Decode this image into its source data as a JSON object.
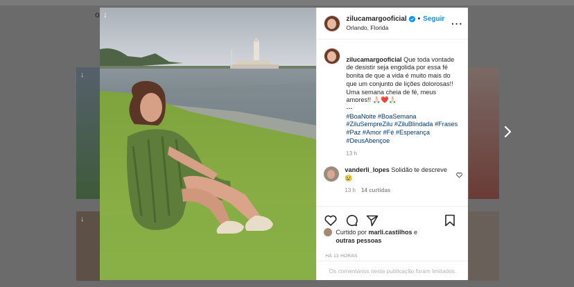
{
  "background": {
    "top_char": "o",
    "close_symbol": "↓",
    "small_icon": "↓"
  },
  "post": {
    "username": "zilucamargooficial",
    "follow_label": "Seguir",
    "location": "Orlando, Florida",
    "more_icon": "more-horizontal-icon",
    "caption": {
      "username": "zilucamargooficial",
      "text": " Que toda vontade de desistir seja engolida por essa fé bonita de que a vida é muito mais do que um conjunto de lições dolorosas!!\nUma semana cheia de fé, meus amores!! 🙏🏻❤️🙏🏻\n---\n",
      "hashtags": "#BoaNoite #BoaSemana #ZiluSempreZilu #ZiluBlindada #Frases #Paz #Amor #Fé #Esperança #DeusAbençoe",
      "time": "13 h"
    },
    "comment": {
      "username": "vanderli_lopes",
      "text": " Solidão te descreve😢",
      "time": "13 h",
      "likes": "14 curtidas"
    },
    "liked_by": {
      "prefix": "Curtido por ",
      "user": "marli.castilhos",
      "middle": " e ",
      "others": "outras pessoas"
    },
    "timestamp": "HÁ 13 HORAS",
    "comments_limited": "Os comentários nesta publicação foram limitados."
  },
  "colors": {
    "accent": "#0095f6",
    "hashtag": "#00376b",
    "muted": "#8e8e8e"
  }
}
